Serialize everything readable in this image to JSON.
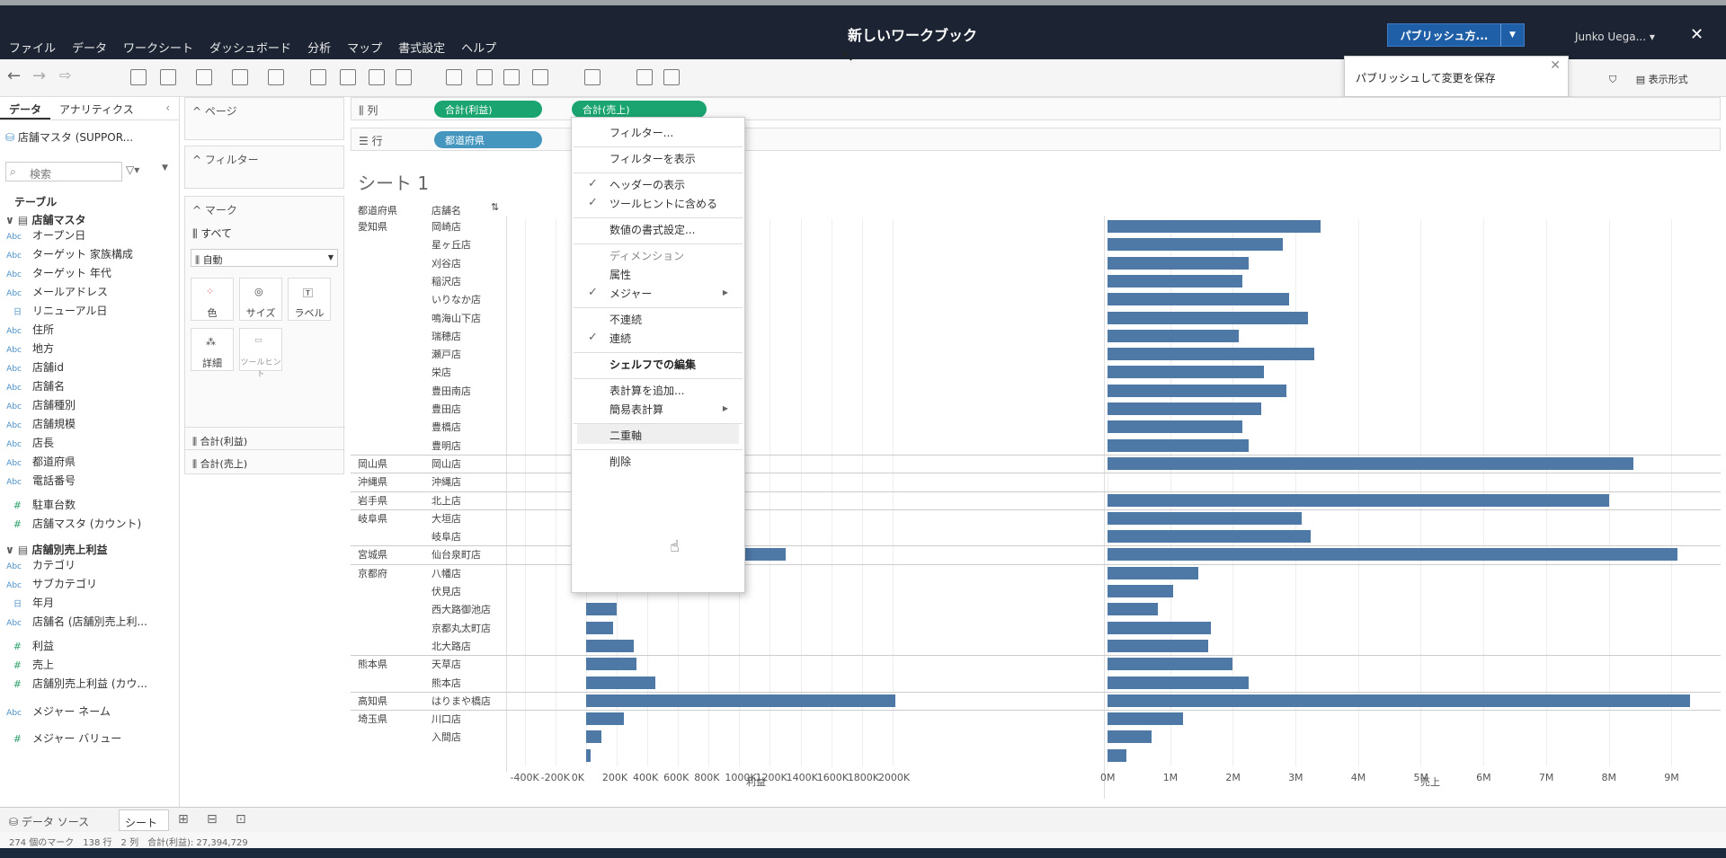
{
  "app": {
    "title": "新しいワークブック",
    "menu": [
      "ファイル",
      "データ",
      "ワークシート",
      "ダッシュボード",
      "分析",
      "マップ",
      "書式設定",
      "ヘルプ"
    ],
    "publish_label": "パブリッシュ方...",
    "publish_tooltip": "パブリッシュして変更を保存",
    "user": "Junko Uega...",
    "show_me": "表示形式",
    "colors": {
      "topbar": "#1c2433",
      "accent": "#1f5fa8",
      "measure_pill": "#1aa470",
      "dim_pill": "#4496be",
      "bar": "#4e79a7"
    }
  },
  "data_pane": {
    "tabs": [
      "データ",
      "アナリティクス"
    ],
    "datasource": "店舗マスタ (SUPPOR...",
    "search_placeholder": "検索",
    "tables_heading": "テーブル",
    "table1": {
      "name": "店舗マスタ",
      "dims": [
        {
          "t": "Abc",
          "n": "オープン日"
        },
        {
          "t": "Abc",
          "n": "ターゲット 家族構成"
        },
        {
          "t": "Abc",
          "n": "ターゲット 年代"
        },
        {
          "t": "Abc",
          "n": "メールアドレス"
        },
        {
          "t": "日",
          "n": "リニューアル日"
        },
        {
          "t": "Abc",
          "n": "住所"
        },
        {
          "t": "Abc",
          "n": "地方"
        },
        {
          "t": "Abc",
          "n": "店舗id"
        },
        {
          "t": "Abc",
          "n": "店舗名"
        },
        {
          "t": "Abc",
          "n": "店舗種別"
        },
        {
          "t": "Abc",
          "n": "店舗規模"
        },
        {
          "t": "Abc",
          "n": "店長"
        },
        {
          "t": "Abc",
          "n": "都道府県"
        },
        {
          "t": "Abc",
          "n": "電話番号"
        }
      ],
      "measures": [
        "駐車台数",
        "店舗マスタ (カウント)"
      ]
    },
    "table2": {
      "name": "店舗別売上利益",
      "dims": [
        {
          "t": "Abc",
          "n": "カテゴリ"
        },
        {
          "t": "Abc",
          "n": "サブカテゴリ"
        },
        {
          "t": "日",
          "n": "年月"
        },
        {
          "t": "Abc",
          "n": "店舗名 (店舗別売上利..."
        }
      ],
      "measures": [
        "利益",
        "売上",
        "店舗別売上利益 (カウ..."
      ]
    },
    "measure_names": "メジャー ネーム",
    "measure_values": "メジャー バリュー"
  },
  "shelves": {
    "pages": "ページ",
    "filters": "フィルター",
    "marks": "マーク",
    "all": "すべて",
    "mark_type": "自動",
    "buttons": [
      "色",
      "サイズ",
      "ラベル",
      "詳細",
      "ツールヒント"
    ],
    "mark_cards": [
      "合計(利益)",
      "合計(売上)"
    ],
    "columns_label": "列",
    "rows_label": "行",
    "column_pills": [
      "合計(利益)",
      "合計(売上)"
    ],
    "row_pills": [
      "都道府県"
    ]
  },
  "viz": {
    "sheet_title": "シート 1",
    "header_pref": "都道府県",
    "header_store": "店舗名",
    "x_axis_label_profit": "利益",
    "x_axis_label_sales": "売上"
  },
  "chart_data": {
    "type": "bar",
    "rows": [
      {
        "pref": "愛知県",
        "store": "岡崎店",
        "profit": null,
        "sales": 3.4
      },
      {
        "pref": "",
        "store": "星ヶ丘店",
        "profit": null,
        "sales": 2.8
      },
      {
        "pref": "",
        "store": "刈谷店",
        "profit": null,
        "sales": 2.25
      },
      {
        "pref": "",
        "store": "稲沢店",
        "profit": null,
        "sales": 2.15
      },
      {
        "pref": "",
        "store": "いりなか店",
        "profit": null,
        "sales": 2.9
      },
      {
        "pref": "",
        "store": "鳴海山下店",
        "profit": null,
        "sales": 3.2
      },
      {
        "pref": "",
        "store": "瑞穂店",
        "profit": null,
        "sales": 2.1
      },
      {
        "pref": "",
        "store": "瀬戸店",
        "profit": null,
        "sales": 3.3
      },
      {
        "pref": "",
        "store": "栄店",
        "profit": null,
        "sales": 2.5
      },
      {
        "pref": "",
        "store": "豊田南店",
        "profit": null,
        "sales": 2.85
      },
      {
        "pref": "",
        "store": "豊田店",
        "profit": null,
        "sales": 2.45
      },
      {
        "pref": "",
        "store": "豊橋店",
        "profit": null,
        "sales": 2.15
      },
      {
        "pref": "",
        "store": "豊明店",
        "profit": null,
        "sales": 2.25
      },
      {
        "pref": "岡山県",
        "store": "岡山店",
        "profit": 950,
        "sales": 8.4
      },
      {
        "pref": "沖縄県",
        "store": "沖縄店",
        "profit": null,
        "sales": null
      },
      {
        "pref": "岩手県",
        "store": "北上店",
        "profit": 880,
        "sales": 8.0
      },
      {
        "pref": "岐阜県",
        "store": "大垣店",
        "profit": null,
        "sales": 3.1
      },
      {
        "pref": "",
        "store": "岐阜店",
        "profit": null,
        "sales": 3.25
      },
      {
        "pref": "宮城県",
        "store": "仙台泉町店",
        "profit": 1300,
        "sales": 9.1
      },
      {
        "pref": "京都府",
        "store": "八幡店",
        "profit": null,
        "sales": 1.45
      },
      {
        "pref": "",
        "store": "伏見店",
        "profit": null,
        "sales": 1.05
      },
      {
        "pref": "",
        "store": "西大路御池店",
        "profit": 200,
        "sales": 0.8
      },
      {
        "pref": "",
        "store": "京都丸太町店",
        "profit": 180,
        "sales": 1.65
      },
      {
        "pref": "",
        "store": "北大路店",
        "profit": 310,
        "sales": 1.6
      },
      {
        "pref": "熊本県",
        "store": "天草店",
        "profit": 330,
        "sales": 2.0
      },
      {
        "pref": "",
        "store": "熊本店",
        "profit": 450,
        "sales": 2.25
      },
      {
        "pref": "高知県",
        "store": "はりまや橋店",
        "profit": 2020,
        "sales": 9.3
      },
      {
        "pref": "埼玉県",
        "store": "川口店",
        "profit": 250,
        "sales": 1.2
      },
      {
        "pref": "",
        "store": "入間店",
        "profit": 100,
        "sales": 0.7
      },
      {
        "pref": "",
        "store": "",
        "profit": 30,
        "sales": 0.3
      }
    ],
    "profit_ticks": [
      "-400K",
      "-200K",
      "0K",
      "200K",
      "400K",
      "600K",
      "800K",
      "1000K",
      "1200K",
      "1400K",
      "1600K",
      "1800K",
      "2000K"
    ],
    "sales_ticks": [
      "0M",
      "1M",
      "2M",
      "3M",
      "4M",
      "5M",
      "6M",
      "7M",
      "8M",
      "9M"
    ],
    "profit_range": [
      -450,
      2100
    ],
    "sales_range": [
      0,
      9.7
    ]
  },
  "context_menu": {
    "items": [
      {
        "label": "フィルター...",
        "check": false,
        "sub": false,
        "style": ""
      },
      {
        "sep": true
      },
      {
        "label": "フィルターを表示",
        "check": false,
        "sub": false,
        "style": ""
      },
      {
        "sep": true
      },
      {
        "label": "ヘッダーの表示",
        "check": true,
        "sub": false,
        "style": ""
      },
      {
        "label": "ツールヒントに含める",
        "check": true,
        "sub": false,
        "style": ""
      },
      {
        "sep": true
      },
      {
        "label": "数値の書式設定...",
        "check": false,
        "sub": false,
        "style": ""
      },
      {
        "sep": true
      },
      {
        "label": "ディメンション",
        "check": false,
        "sub": false,
        "style": "dis"
      },
      {
        "label": "属性",
        "check": false,
        "sub": false,
        "style": ""
      },
      {
        "label": "メジャー",
        "check": true,
        "sub": true,
        "style": ""
      },
      {
        "sep": true
      },
      {
        "label": "不連続",
        "check": false,
        "sub": false,
        "style": ""
      },
      {
        "label": "連続",
        "check": true,
        "sub": false,
        "style": ""
      },
      {
        "sep": true
      },
      {
        "label": "シェルフでの編集",
        "check": false,
        "sub": false,
        "style": "bold"
      },
      {
        "sep": true
      },
      {
        "label": "表計算を追加...",
        "check": false,
        "sub": false,
        "style": ""
      },
      {
        "label": "簡易表計算",
        "check": false,
        "sub": true,
        "style": ""
      },
      {
        "sep": true
      },
      {
        "label": "二重軸",
        "check": false,
        "sub": false,
        "style": "hl"
      },
      {
        "sep": true
      },
      {
        "label": "削除",
        "check": false,
        "sub": false,
        "style": ""
      }
    ]
  },
  "bottom": {
    "datasource_tab": "データ ソース",
    "sheet_tab": "シート 1",
    "status": "274 個のマーク　138 行　2 列　合計(利益): 27,394,729"
  }
}
